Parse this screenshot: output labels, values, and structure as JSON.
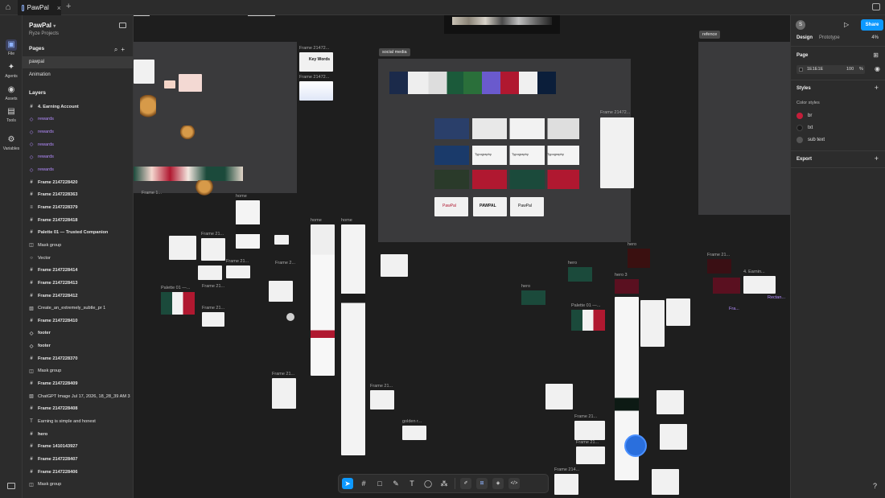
{
  "titlebar": {
    "tab_label": "PawPal",
    "close": "×",
    "add": "+"
  },
  "rail": [
    {
      "label": "File",
      "icon": "file-icon",
      "glyph": "▣"
    },
    {
      "label": "Agents",
      "icon": "agents-icon",
      "glyph": "✦"
    },
    {
      "label": "Assets",
      "icon": "assets-icon",
      "glyph": "◉"
    },
    {
      "label": "Tools",
      "icon": "tools-icon",
      "glyph": "▤"
    },
    {
      "label": "Variables",
      "icon": "variables-icon",
      "glyph": "⚙"
    }
  ],
  "project": {
    "name": "PawPal",
    "team": "Ryze Projects",
    "chevron": "▾"
  },
  "pages": {
    "title": "Pages",
    "items": [
      "pawpal",
      "Animation"
    ]
  },
  "layers": {
    "title": "Layers",
    "items": [
      {
        "label": "4. Earning Account",
        "icon": "frame-icon",
        "glyph": "#",
        "kind": "bold"
      },
      {
        "label": "rewards",
        "icon": "component-icon",
        "glyph": "◇",
        "kind": "comp"
      },
      {
        "label": "rewards",
        "icon": "component-icon",
        "glyph": "◇",
        "kind": "comp"
      },
      {
        "label": "rewards",
        "icon": "component-icon",
        "glyph": "◇",
        "kind": "comp"
      },
      {
        "label": "rewards",
        "icon": "component-icon",
        "glyph": "◇",
        "kind": "comp"
      },
      {
        "label": "rewards",
        "icon": "component-icon",
        "glyph": "◇",
        "kind": "comp"
      },
      {
        "label": "Frame 2147228420",
        "icon": "frame-icon",
        "glyph": "#",
        "kind": "bold"
      },
      {
        "label": "Frame 2147228363",
        "icon": "frame-icon",
        "glyph": "#",
        "kind": "bold"
      },
      {
        "label": "Frame 2147228379",
        "icon": "frame-icon",
        "glyph": "≡",
        "kind": "bold"
      },
      {
        "label": "Frame 2147228418",
        "icon": "frame-icon",
        "glyph": "#",
        "kind": "bold"
      },
      {
        "label": "Palette 01 — Trusted Companion",
        "icon": "frame-icon",
        "glyph": "#",
        "kind": "bold"
      },
      {
        "label": "Mask group",
        "icon": "mask-icon",
        "glyph": "◫",
        "kind": ""
      },
      {
        "label": "Vector",
        "icon": "vector-icon",
        "glyph": "○",
        "kind": ""
      },
      {
        "label": "Frame 2147228414",
        "icon": "frame-icon",
        "glyph": "#",
        "kind": "bold"
      },
      {
        "label": "Frame 2147228413",
        "icon": "frame-icon",
        "glyph": "#",
        "kind": "bold"
      },
      {
        "label": "Frame 2147228412",
        "icon": "frame-icon",
        "glyph": "#",
        "kind": "bold"
      },
      {
        "label": "Create_an_extremely_subtle_pr 1",
        "icon": "image-icon",
        "glyph": "▧",
        "kind": ""
      },
      {
        "label": "Frame 2147228410",
        "icon": "frame-icon",
        "glyph": "#",
        "kind": "bold"
      },
      {
        "label": "footer",
        "icon": "component-icon",
        "glyph": "◇",
        "kind": "bold"
      },
      {
        "label": "footer",
        "icon": "component-icon",
        "glyph": "◇",
        "kind": "bold"
      },
      {
        "label": "Frame 2147228370",
        "icon": "frame-icon",
        "glyph": "#",
        "kind": "bold"
      },
      {
        "label": "Mask group",
        "icon": "mask-icon",
        "glyph": "◫",
        "kind": ""
      },
      {
        "label": "Frame 2147228409",
        "icon": "frame-icon",
        "glyph": "#",
        "kind": "bold"
      },
      {
        "label": "ChatGPT Image Jul 17, 2026, 18_28_39 AM 3",
        "icon": "image-icon",
        "glyph": "▧",
        "kind": ""
      },
      {
        "label": "Frame 2147228408",
        "icon": "frame-icon",
        "glyph": "#",
        "kind": "bold"
      },
      {
        "label": "Earning is simple and honest",
        "icon": "text-icon",
        "glyph": "T",
        "kind": ""
      },
      {
        "label": "hero",
        "icon": "frame-icon",
        "glyph": "#",
        "kind": "bold"
      },
      {
        "label": "Frame 1410143927",
        "icon": "frame-icon",
        "glyph": "#",
        "kind": "bold"
      },
      {
        "label": "Frame 2147228407",
        "icon": "frame-icon",
        "glyph": "#",
        "kind": "bold"
      },
      {
        "label": "Frame 2147228406",
        "icon": "frame-icon",
        "glyph": "#",
        "kind": "bold"
      },
      {
        "label": "Mask group",
        "icon": "mask-icon",
        "glyph": "◫",
        "kind": ""
      }
    ]
  },
  "canvas": {
    "tag_social": "social media",
    "tag_refence": "refence",
    "frame_labels": [
      "Frame 21472...",
      "Frame 21472...",
      "Frame 21472...",
      "Frame 1...",
      "home",
      "home",
      "home",
      "Frame 21...",
      "Frame 2...",
      "Frame 21...",
      "Palette 01 —...",
      "Frame 21...",
      "Frame 21...",
      "Frame 21...",
      "Frame 21...",
      "golden r...",
      "hero",
      "hero",
      "hero",
      "hero 3",
      "Palette 01 —...",
      "Frame 21...",
      "Frame 21...",
      "Frame 214...",
      "Frame 21...",
      "4. Earnin...",
      "Fra...",
      "Rectan..."
    ],
    "mini_texts": [
      "Key Words",
      "PawPal",
      "PAWPAL",
      "PawPal",
      "Typography",
      "Typography",
      "Typography"
    ]
  },
  "toolbar": {
    "tools": [
      {
        "name": "move-tool-button",
        "glyph": "➤"
      },
      {
        "name": "frame-tool-button",
        "glyph": "#"
      },
      {
        "name": "rectangle-tool-button",
        "glyph": "□"
      },
      {
        "name": "pen-tool-button",
        "glyph": "✎"
      },
      {
        "name": "text-tool-button",
        "glyph": "T"
      },
      {
        "name": "comment-tool-button",
        "glyph": "◯"
      },
      {
        "name": "actions-tool-button",
        "glyph": "⁂"
      }
    ],
    "modes": [
      {
        "name": "draw-mode-button",
        "glyph": "✐"
      },
      {
        "name": "design-mode-button",
        "glyph": "⊞"
      },
      {
        "name": "prototype-mode-button",
        "glyph": "◈"
      },
      {
        "name": "dev-mode-button",
        "glyph": "</>"
      }
    ]
  },
  "rightpanel": {
    "avatar": "S",
    "share": "Share",
    "tabs": [
      "Design",
      "Prototype"
    ],
    "zoom": "4%",
    "page": {
      "title": "Page",
      "color": "1E1E1E",
      "opacity": "100",
      "pct": "%"
    },
    "styles": {
      "title": "Styles",
      "subtitle": "Color styles",
      "items": [
        {
          "label": "br",
          "color": "#c41e3a"
        },
        {
          "label": "txt",
          "color": "#1a1a1a"
        },
        {
          "label": "sub text",
          "color": "#555555"
        }
      ]
    },
    "export": "Export",
    "help": "?"
  },
  "colors": {
    "accent": "#0d99ff",
    "brand_red": "#b01830",
    "canvas": "#1e1e1e",
    "panel": "#2c2c2c"
  }
}
